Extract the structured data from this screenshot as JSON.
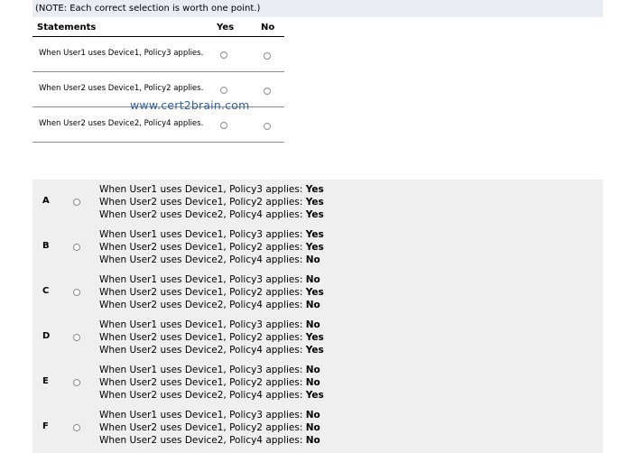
{
  "note": "(NOTE: Each correct selection is worth one point.)",
  "table": {
    "col_statements": "Statements",
    "col_yes": "Yes",
    "col_no": "No",
    "rows": [
      {
        "text": "When User1 uses Device1, Policy3 applies."
      },
      {
        "text": "When User2 uses Device1, Policy2 applies."
      },
      {
        "text": "When User2 uses Device2, Policy4 applies."
      }
    ]
  },
  "watermark": "www.cert2brain.com",
  "answers": [
    {
      "letter": "A",
      "lines": [
        {
          "text": "When User1 uses Device1, Policy3 applies: ",
          "value": "Yes"
        },
        {
          "text": "When User2 uses Device1, Policy2 applies: ",
          "value": "Yes"
        },
        {
          "text": "When User2 uses Device2, Policy4 applies: ",
          "value": "Yes"
        }
      ]
    },
    {
      "letter": "B",
      "lines": [
        {
          "text": "When User1 uses Device1, Policy3 applies: ",
          "value": "Yes"
        },
        {
          "text": "When User2 uses Device1, Policy2 applies: ",
          "value": "Yes"
        },
        {
          "text": "When User2 uses Device2, Policy4 applies: ",
          "value": "No"
        }
      ]
    },
    {
      "letter": "C",
      "lines": [
        {
          "text": "When User1 uses Device1, Policy3 applies: ",
          "value": "No"
        },
        {
          "text": "When User2 uses Device1, Policy2 applies: ",
          "value": "Yes"
        },
        {
          "text": "When User2 uses Device2, Policy4 applies: ",
          "value": "No"
        }
      ]
    },
    {
      "letter": "D",
      "lines": [
        {
          "text": "When User1 uses Device1, Policy3 applies: ",
          "value": "No"
        },
        {
          "text": "When User2 uses Device1, Policy2 applies: ",
          "value": "Yes"
        },
        {
          "text": "When User2 uses Device2, Policy4 applies: ",
          "value": "Yes"
        }
      ]
    },
    {
      "letter": "E",
      "lines": [
        {
          "text": "When User1 uses Device1, Policy3 applies: ",
          "value": "No"
        },
        {
          "text": "When User2 uses Device1, Policy2 applies: ",
          "value": "No"
        },
        {
          "text": "When User2 uses Device2, Policy4 applies: ",
          "value": "Yes"
        }
      ]
    },
    {
      "letter": "F",
      "lines": [
        {
          "text": "When User1 uses Device1, Policy3 applies: ",
          "value": "No"
        },
        {
          "text": "When User2 uses Device1, Policy2 applies: ",
          "value": "No"
        },
        {
          "text": "When User2 uses Device2, Policy4 applies: ",
          "value": "No"
        }
      ]
    }
  ]
}
